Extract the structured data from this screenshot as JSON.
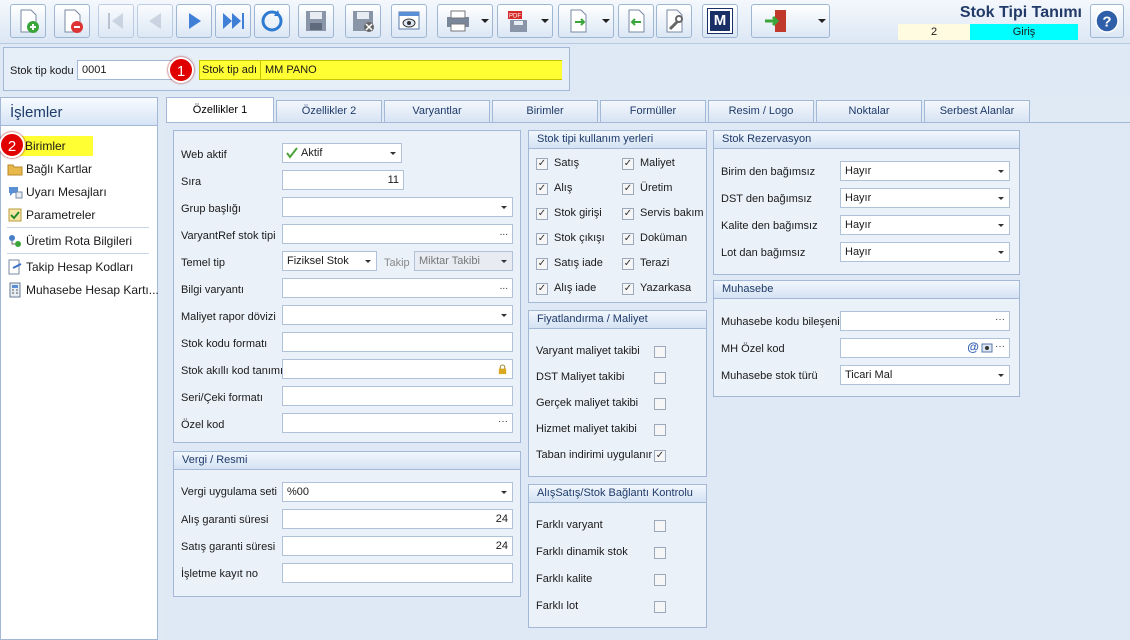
{
  "app": {
    "title": "Stok Tipi Tanımı",
    "record_no": "2",
    "mode": "Giriş"
  },
  "toolbar": {
    "buttons": [
      {
        "name": "new-icon"
      },
      {
        "name": "delete-icon"
      },
      {
        "name": "first-icon"
      },
      {
        "name": "previous-icon"
      },
      {
        "name": "next-icon"
      },
      {
        "name": "last-icon"
      },
      {
        "name": "refresh-icon"
      },
      {
        "name": "save-icon"
      },
      {
        "name": "save-close-icon"
      },
      {
        "name": "preview-icon"
      },
      {
        "name": "print-icon"
      },
      {
        "name": "pdf-icon"
      },
      {
        "name": "export-icon"
      },
      {
        "name": "import-icon"
      },
      {
        "name": "tools-icon"
      },
      {
        "name": "m-icon"
      },
      {
        "name": "exit-icon"
      }
    ],
    "m_label": "M",
    "pdf_label": "PDF"
  },
  "header": {
    "code_label": "Stok tip kodu",
    "code_value": "0001",
    "name_label": "Stok tip adı",
    "name_value": "MM PANO",
    "badge1": "1",
    "badge2": "2"
  },
  "sidebar": {
    "title": "İşlemler",
    "items": [
      {
        "label": "Birimler",
        "icon": "units-icon"
      },
      {
        "label": "Bağlı Kartlar",
        "icon": "folder-icon"
      },
      {
        "label": "Uyarı Mesajları",
        "icon": "message-icon"
      },
      {
        "label": "Parametreler",
        "icon": "parameters-icon"
      },
      {
        "label": "Üretim Rota Bilgileri",
        "icon": "route-icon"
      },
      {
        "label": "Takip Hesap Kodları",
        "icon": "tracking-icon"
      },
      {
        "label": "Muhasebe Hesap Kartı...",
        "icon": "accounting-icon"
      }
    ]
  },
  "tabs": [
    "Özellikler 1",
    "Özellikler 2",
    "Varyantlar",
    "Birimler",
    "Formüller",
    "Resim / Logo",
    "Noktalar",
    "Serbest Alanlar"
  ],
  "general": {
    "web_aktif_label": "Web aktif",
    "web_aktif_value": "Aktif",
    "sira_label": "Sıra",
    "sira_value": "11",
    "grup_label": "Grup başlığı",
    "varyantref_label": "VaryantRef stok tipi",
    "temel_tip_label": "Temel tip",
    "temel_tip_value": "Fiziksel Stok",
    "takip_label": "Takip",
    "takip_value": "Miktar Takibi",
    "bilgi_varyanti_label": "Bilgi varyantı",
    "maliyet_doviz_label": "Maliyet rapor dövizi",
    "stok_kodu_formati_label": "Stok kodu formatı",
    "stok_akilli_label": "Stok akıllı kod tanımı",
    "seri_ceki_label": "Seri/Çeki formatı",
    "ozel_kod_label": "Özel kod",
    "lookup_glyph": "...",
    "lookup_dots": "···"
  },
  "vergi": {
    "title": "Vergi / Resmi",
    "uygulama_label": "Vergi uygulama seti",
    "uygulama_value": "%00",
    "alis_garanti_label": "Alış garanti süresi",
    "alis_garanti_value": "24",
    "satis_garanti_label": "Satış garanti süresi",
    "satis_garanti_value": "24",
    "isletme_label": "İşletme kayıt no"
  },
  "kullanim": {
    "title": "Stok tipi kullanım yerleri",
    "col1": [
      {
        "label": "Satış"
      },
      {
        "label": "Alış"
      },
      {
        "label": "Stok girişi"
      },
      {
        "label": "Stok çıkışı"
      },
      {
        "label": "Satış iade"
      },
      {
        "label": "Alış iade"
      }
    ],
    "col2": [
      {
        "label": "Maliyet"
      },
      {
        "label": "Üretim"
      },
      {
        "label": "Servis bakım"
      },
      {
        "label": "Doküman"
      },
      {
        "label": "Terazi"
      },
      {
        "label": "Yazarkasa"
      }
    ],
    "check_glyph": "✓"
  },
  "fiyat": {
    "title": "Fiyatlandırma / Maliyet",
    "items": [
      {
        "label": "Varyant maliyet takibi",
        "checked": false
      },
      {
        "label": "DST Maliyet takibi",
        "checked": false
      },
      {
        "label": "Gerçek maliyet takibi",
        "checked": false
      },
      {
        "label": "Hizmet maliyet takibi",
        "checked": false
      },
      {
        "label": "Taban indirimi uygulanır",
        "checked": true
      }
    ]
  },
  "bagl": {
    "title": "AlışSatış/Stok Bağlantı Kontrolu",
    "items": [
      {
        "label": "Farklı varyant"
      },
      {
        "label": "Farklı dinamik stok"
      },
      {
        "label": "Farklı kalite"
      },
      {
        "label": "Farklı lot"
      }
    ]
  },
  "rez": {
    "title": "Stok Rezervasyon",
    "items": [
      {
        "label": "Birim den bağımsız",
        "value": "Hayır"
      },
      {
        "label": "DST den bağımsız",
        "value": "Hayır"
      },
      {
        "label": "Kalite den bağımsız",
        "value": "Hayır"
      },
      {
        "label": "Lot dan bağımsız",
        "value": "Hayır"
      }
    ]
  },
  "muh": {
    "title": "Muhasebe",
    "kod_label": "Muhasebe kodu bileşeni",
    "mh_label": "MH Özel kod",
    "stok_turu_label": "Muhasebe stok türü",
    "stok_turu_value": "Ticari Mal",
    "at_glyph": "@"
  },
  "colors": {
    "highlight": "#ffff33",
    "mode_bg": "#00ffff",
    "badge": "#e00000",
    "title": "#223a67"
  }
}
